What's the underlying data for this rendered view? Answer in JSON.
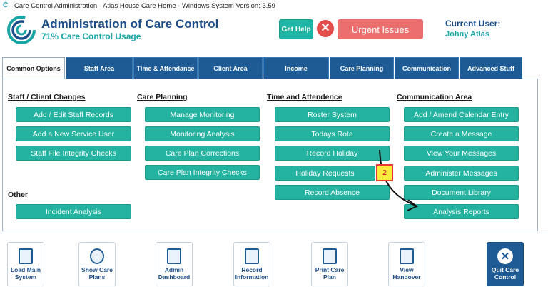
{
  "window": {
    "title": "Care Control Administration - Atlas House Care Home - Windows System Version: 3.59"
  },
  "header": {
    "title": "Administration of Care Control",
    "subtitle": "71% Care Control Usage",
    "get_help": "Get Help",
    "urgent": "Urgent Issues",
    "current_user_label": "Current User:",
    "current_user_name": "Johny Atlas"
  },
  "tabs": [
    {
      "label": "Common Options"
    },
    {
      "label": "Staff Area"
    },
    {
      "label": "Time & Attendance"
    },
    {
      "label": "Client Area"
    },
    {
      "label": "Income"
    },
    {
      "label": "Care Planning"
    },
    {
      "label": "Communication"
    },
    {
      "label": "Advanced Stuff"
    }
  ],
  "sections": {
    "staff_client": {
      "heading": "Staff / Client Changes",
      "buttons": [
        "Add / Edit Staff Records",
        "Add a New Service User",
        "Staff File Integrity Checks"
      ]
    },
    "care_planning": {
      "heading": "Care Planning",
      "buttons": [
        "Manage Monitoring",
        "Monitoring Analysis",
        "Care Plan Corrections",
        "Care Plan Integrity Checks"
      ]
    },
    "time_attendance": {
      "heading": "Time and Attendence",
      "buttons": [
        "Roster System",
        "Todays Rota",
        "Record Holiday",
        "Holiday Requests",
        "Record Absence"
      ]
    },
    "communication": {
      "heading": "Communication Area",
      "buttons": [
        "Add / Amend Calendar Entry",
        "Create a Message",
        "View Your Messages",
        "Administer Messages",
        "Document Library",
        "Analysis Reports"
      ]
    },
    "other": {
      "heading": "Other",
      "buttons": [
        "Incident Analysis"
      ]
    }
  },
  "callout": {
    "number": "2"
  },
  "bottom_bar": [
    {
      "label_1": "Load Main",
      "label_2": "System"
    },
    {
      "label_1": "Show Care",
      "label_2": "Plans"
    },
    {
      "label_1": "Admin",
      "label_2": "Dashboard"
    },
    {
      "label_1": "Record",
      "label_2": "Information"
    },
    {
      "label_1": "Print Care",
      "label_2": "Plan"
    },
    {
      "label_1": "View",
      "label_2": "Handover"
    },
    {
      "label_1": "Quit Care",
      "label_2": "Control"
    }
  ],
  "colors": {
    "accent": "#24b3a0",
    "nav": "#1e5b95",
    "urgent": "#ec6f6f",
    "callout": "#ffeb3b"
  }
}
